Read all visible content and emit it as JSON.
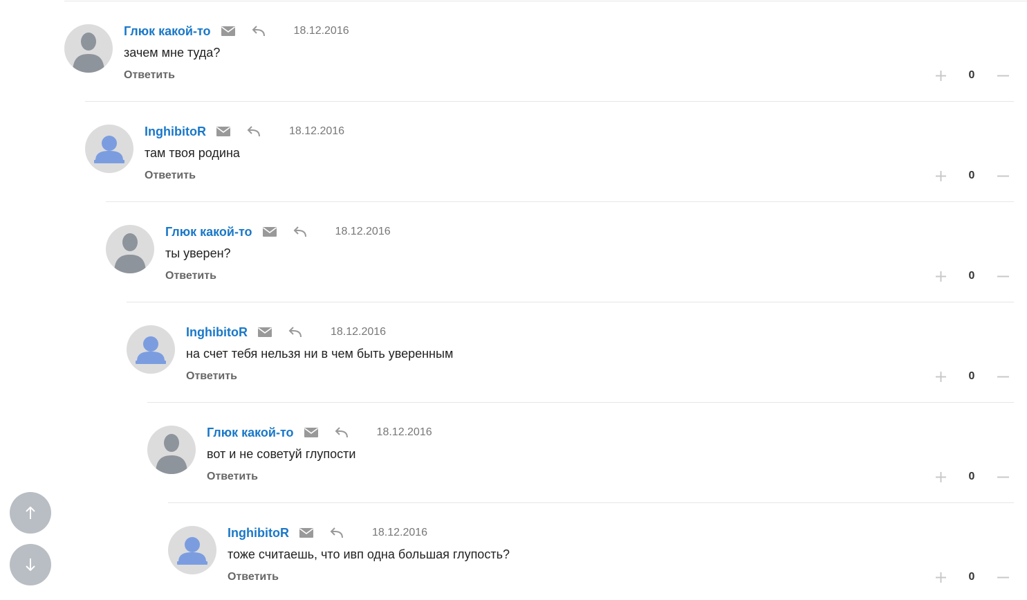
{
  "ui": {
    "reply_label": "Ответить"
  },
  "comments": [
    {
      "author": "Глюк какой-то",
      "date": "18.12.2016",
      "text": "зачем мне туда?",
      "score": "0",
      "avatar": "gray-silhouette"
    },
    {
      "author": "InghibitoR",
      "date": "18.12.2016",
      "text": "там твоя родина",
      "score": "0",
      "avatar": "blue-silhouette"
    },
    {
      "author": "Глюк какой-то",
      "date": "18.12.2016",
      "text": "ты уверен?",
      "score": "0",
      "avatar": "gray-silhouette"
    },
    {
      "author": "InghibitoR",
      "date": "18.12.2016",
      "text": "на счет тебя нельзя ни в чем быть уверенным",
      "score": "0",
      "avatar": "blue-silhouette"
    },
    {
      "author": "Глюк какой-то",
      "date": "18.12.2016",
      "text": "вот и не советуй глупости",
      "score": "0",
      "avatar": "gray-silhouette"
    },
    {
      "author": "InghibitoR",
      "date": "18.12.2016",
      "text": "тоже считаешь, что ивп одна большая глупость?",
      "score": "0",
      "avatar": "blue-silhouette"
    }
  ],
  "icons": {
    "mail": "mail-icon",
    "reply": "reply-arrow-icon",
    "upvote": "plus-icon",
    "downvote": "minus-icon",
    "scroll_up": "arrow-up-icon",
    "scroll_down": "arrow-down-icon"
  },
  "colors": {
    "author_link": "#1a78c8",
    "meta_text": "#777777",
    "reply_link": "#666666",
    "icon_gray": "#999999",
    "vote_icon": "#c8c8c8",
    "scroll_button": "#b9bec4",
    "avatar_gray": "#8e949c",
    "avatar_blue": "#7b9de0"
  }
}
